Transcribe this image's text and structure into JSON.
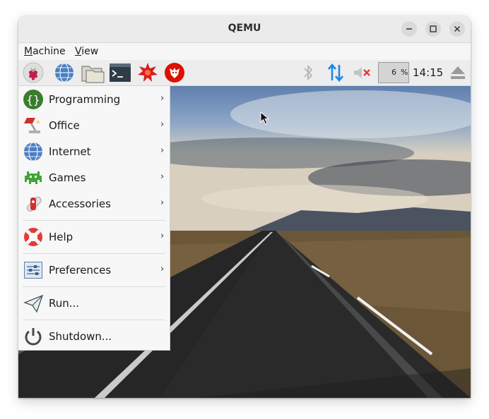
{
  "window": {
    "title": "QEMU"
  },
  "menubar": {
    "items": [
      {
        "mnemonic": "M",
        "rest": "achine"
      },
      {
        "mnemonic": "V",
        "rest": "iew"
      }
    ]
  },
  "taskbar": {
    "launchers": [
      "raspberry-menu-icon",
      "web-browser-icon",
      "file-manager-icon",
      "terminal-icon",
      "mathematica-icon",
      "wolfram-icon"
    ],
    "cpu_value": "6",
    "cpu_unit": "%",
    "clock": "14:15"
  },
  "start_menu": {
    "items": [
      {
        "label": "Programming",
        "icon": "programming-icon"
      },
      {
        "label": "Office",
        "icon": "office-icon"
      },
      {
        "label": "Internet",
        "icon": "internet-icon"
      },
      {
        "label": "Games",
        "icon": "games-icon"
      },
      {
        "label": "Accessories",
        "icon": "accessories-icon"
      },
      {
        "label": "Help",
        "icon": "help-icon"
      },
      {
        "label": "Preferences",
        "icon": "preferences-icon"
      },
      {
        "label": "Run...",
        "icon": "run-icon"
      },
      {
        "label": "Shutdown...",
        "icon": "shutdown-icon"
      }
    ],
    "submenu_arrow": "›"
  },
  "colors": {
    "bluetooth_inactive": "#b5b5b5",
    "network_arrows": "#1e88e5",
    "mute_x": "#e53935",
    "raspberry": "#c51a4a"
  }
}
